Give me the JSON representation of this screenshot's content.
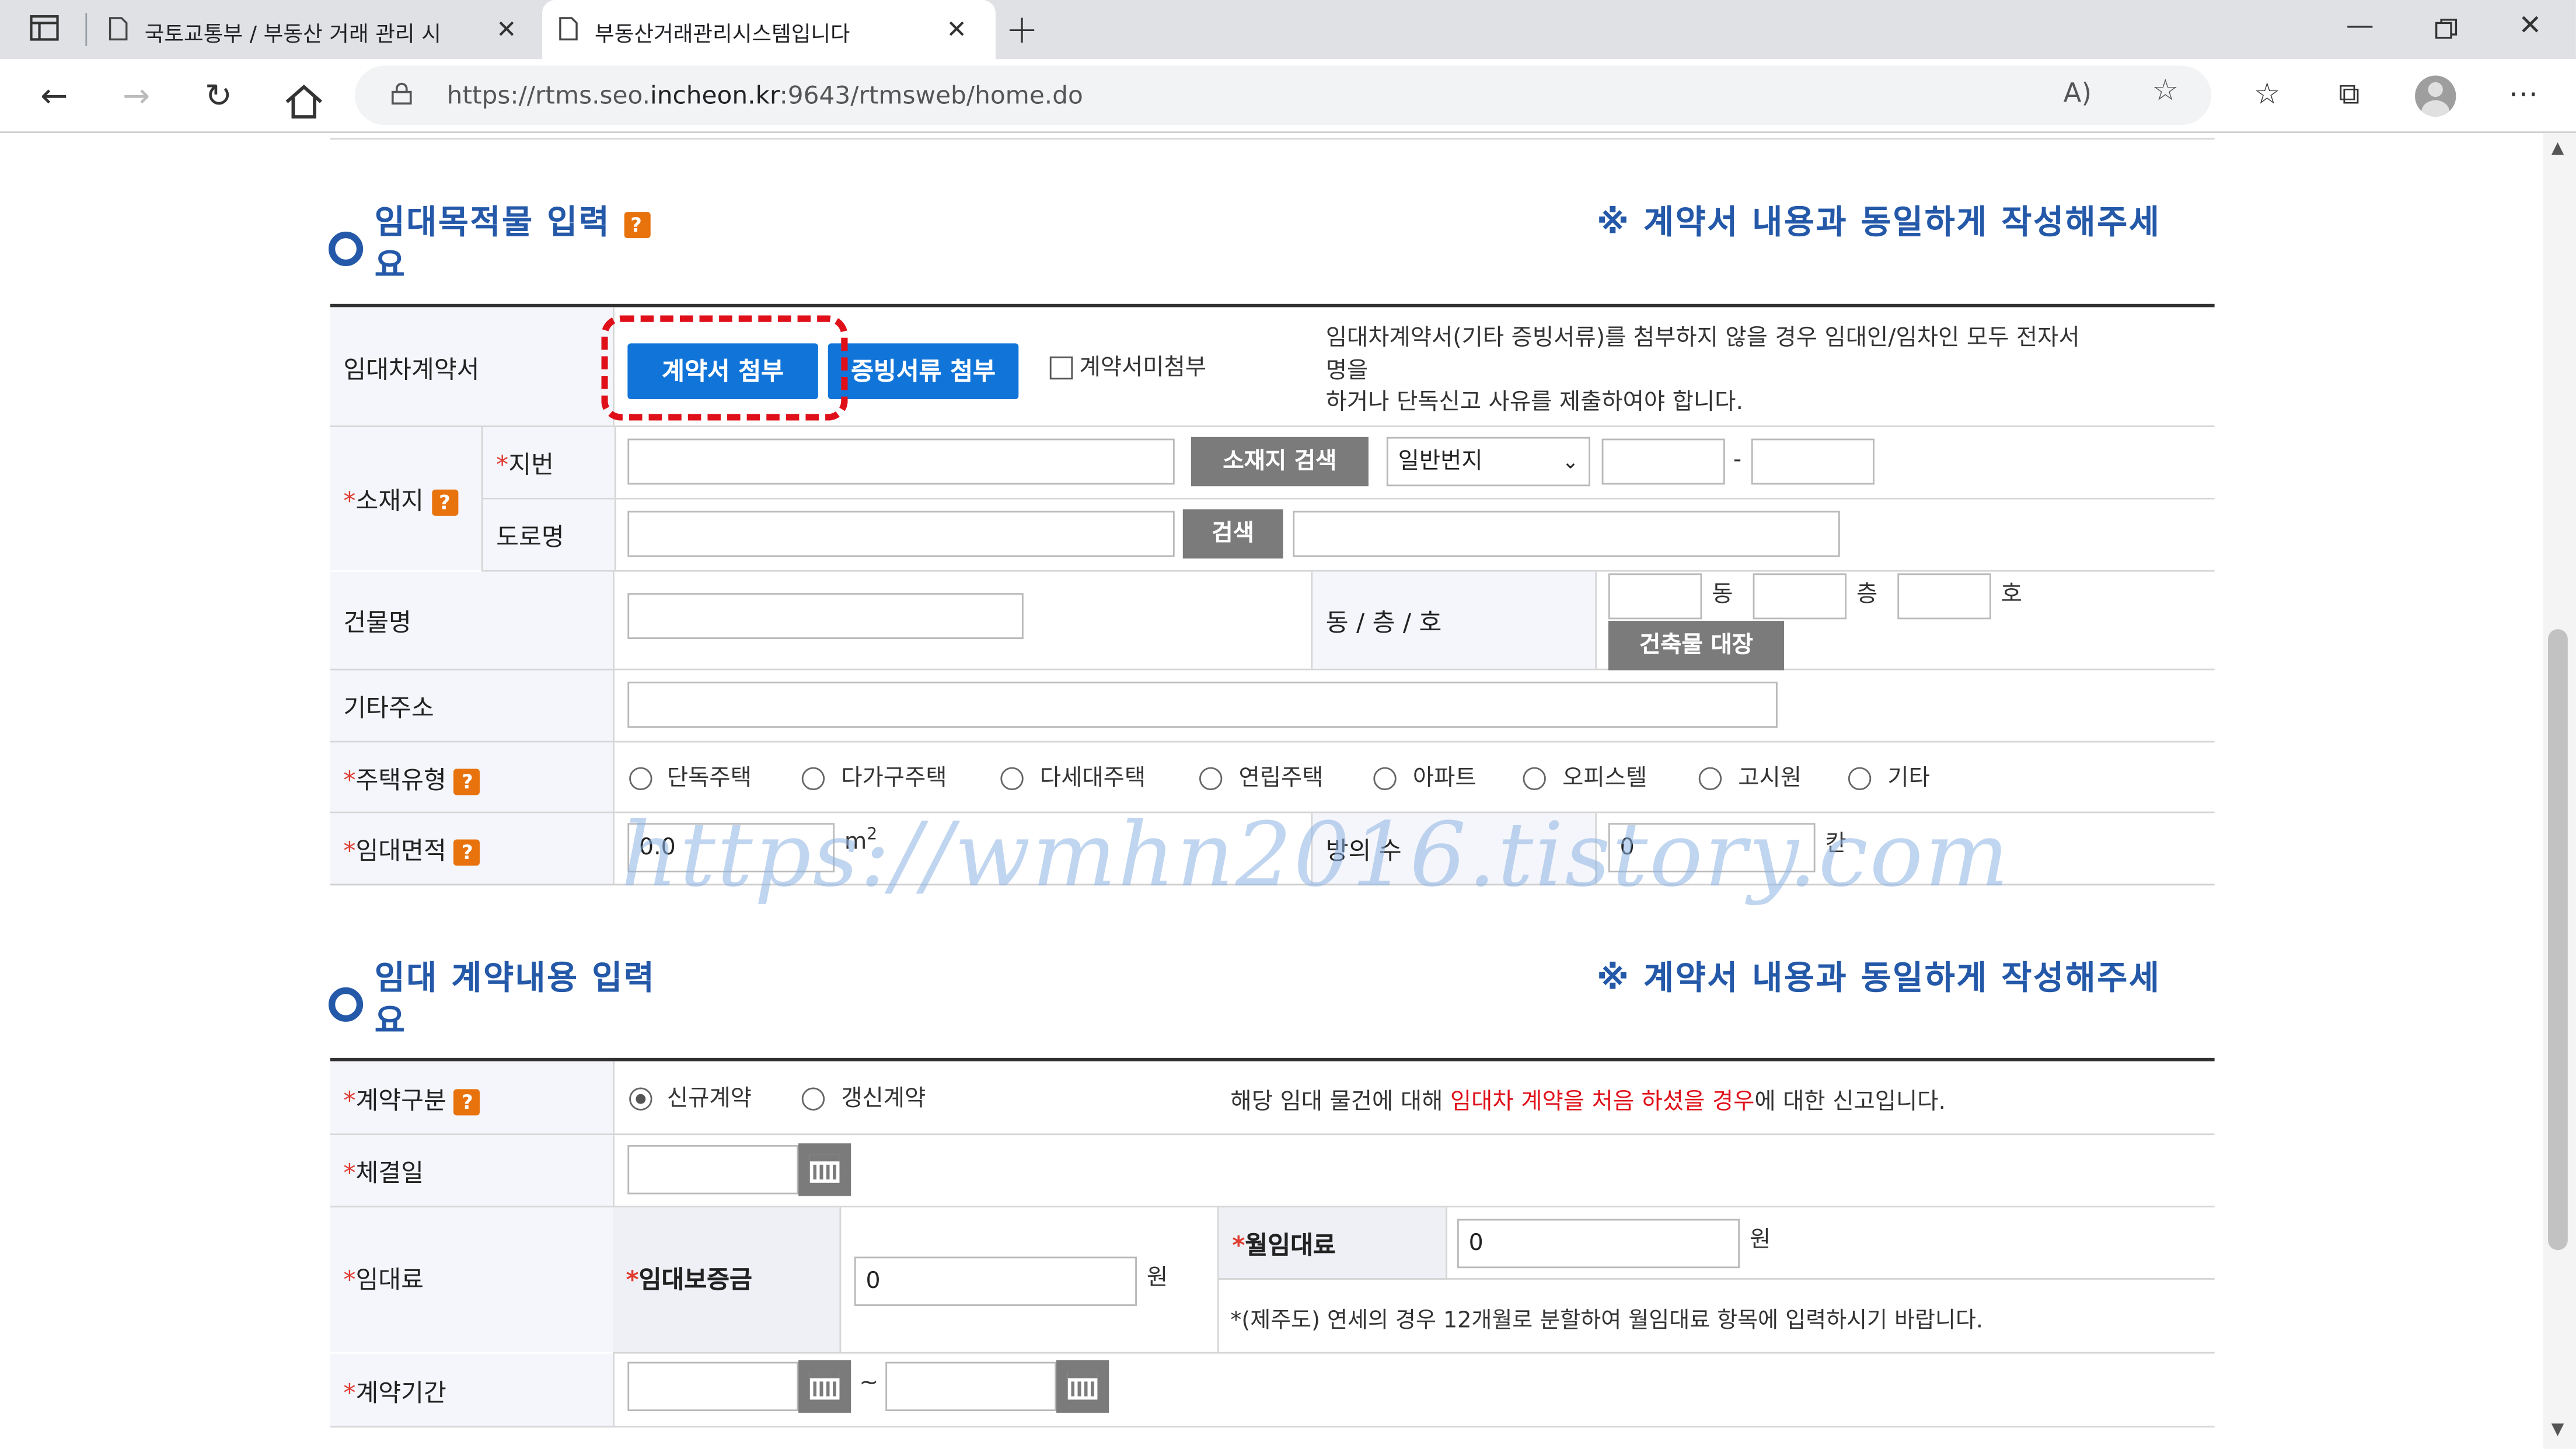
{
  "browser": {
    "tabs": [
      {
        "title": "국토교통부 / 부동산 거래 관리 시",
        "active": false
      },
      {
        "title": "부동산거래관리시스템입니다",
        "active": true
      }
    ],
    "url_prefix": "https://rtms.seo.",
    "url_host": "incheon.kr",
    "url_suffix": ":9643/rtmsweb/home.do"
  },
  "section1": {
    "title_line1": "임대목적물 입력",
    "title_line2": "요",
    "notice": "※ 계약서 내용과 동일하게 작성해주세",
    "contract": {
      "label": "임대차계약서",
      "attach_button": "계약서 첨부",
      "evidence_button": "증빙서류 첨부",
      "no_attach_checkbox": "계약서미첨부",
      "note_line1": "임대차계약서(기타 증빙서류)를 첨부하지 않을 경우 임대인/임차인 모두 전자서",
      "note_line2": "명을",
      "note_line3": "하거나 단독신고 사유를 제출하여야 합니다."
    },
    "location": {
      "label": "소재지",
      "jibun_label": "지번",
      "search_button": "소재지 검색",
      "select_value": "일반번지",
      "dash": "-",
      "road_label": "도로명",
      "road_search_button": "검색"
    },
    "building": {
      "label": "건물명",
      "dong_label": "동 / 층 / 호",
      "dong": "동",
      "floor": "층",
      "ho": "호",
      "register_button": "건축물 대장"
    },
    "etc_address": {
      "label": "기타주소"
    },
    "house_type": {
      "label": "주택유형",
      "options": [
        "단독주택",
        "다가구주택",
        "다세대주택",
        "연립주택",
        "아파트",
        "오피스텔",
        "고시원",
        "기타"
      ]
    },
    "area": {
      "label": "임대면적",
      "value": "0.0",
      "unit": "m",
      "unit_sup": "2",
      "rooms_label": "방의 수",
      "rooms_value": "0",
      "rooms_unit": "칸"
    }
  },
  "section2": {
    "title_line1": "임대 계약내용 입력",
    "title_line2": "요",
    "notice": "※ 계약서 내용과 동일하게 작성해주세",
    "contract_type": {
      "label": "계약구분",
      "options": [
        "신규계약",
        "갱신계약"
      ],
      "selected": "신규계약",
      "desc_before": "해당 임대 물건에 대해 ",
      "desc_highlight": "임대차 계약을 처음 하셨을 경우",
      "desc_after": "에 대한 신고입니다."
    },
    "signed_date": {
      "label": "체결일"
    },
    "rent": {
      "label": "임대료",
      "deposit_label": "임대보증금",
      "deposit_value": "0",
      "deposit_unit": "원",
      "monthly_label": "월임대료",
      "monthly_value": "0",
      "monthly_unit": "원",
      "note": "*(제주도) 연세의 경우 12개월로 분할하여 월임대료 항목에 입력하시기 바랍니다."
    },
    "period": {
      "label": "계약기간",
      "tilde": "~"
    }
  },
  "watermark": "https://wmhn2016.tistory.com",
  "colors": {
    "accent": "#2458a8",
    "primary_button": "#1174d9",
    "highlight": "#e0101a",
    "help": "#e8720c"
  }
}
